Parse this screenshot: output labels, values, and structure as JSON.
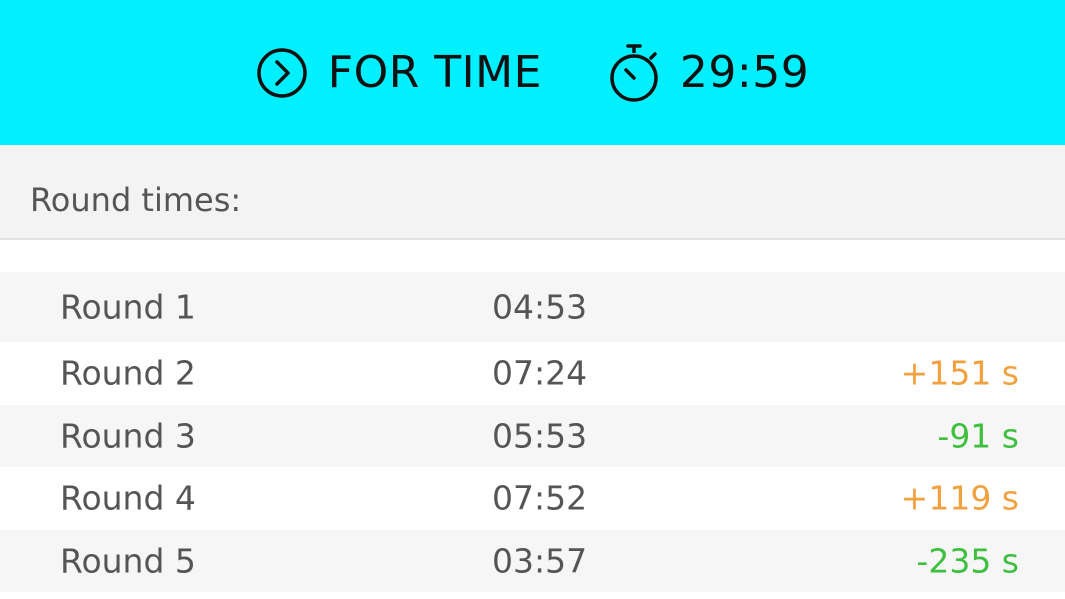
{
  "header": {
    "mode_icon": "play-circle-icon",
    "mode_label": "FOR TIME",
    "timer_icon": "stopwatch-icon",
    "timer_value": "29:59",
    "background_color": "#00f0ff"
  },
  "section": {
    "title": "Round times:"
  },
  "rounds": [
    {
      "label": "Round 1",
      "time": "04:53",
      "delta": "",
      "delta_type": ""
    },
    {
      "label": "Round 2",
      "time": "07:24",
      "delta": "+151 s",
      "delta_type": "plus"
    },
    {
      "label": "Round 3",
      "time": "05:53",
      "delta": "-91 s",
      "delta_type": "minus"
    },
    {
      "label": "Round 4",
      "time": "07:52",
      "delta": "+119 s",
      "delta_type": "plus"
    },
    {
      "label": "Round 5",
      "time": "03:57",
      "delta": "-235 s",
      "delta_type": "minus"
    }
  ],
  "colors": {
    "delta_plus": "#f2a13f",
    "delta_minus": "#3fbf3f"
  }
}
